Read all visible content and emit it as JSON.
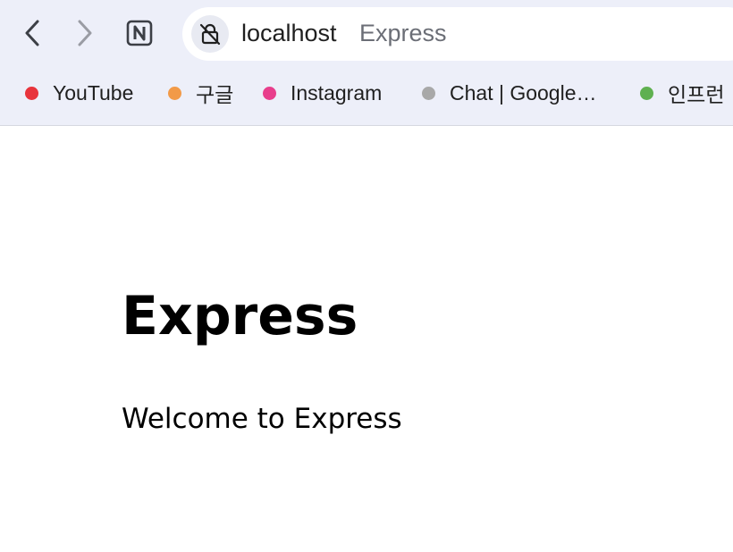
{
  "toolbar": {
    "back_icon": "chevron-left-icon",
    "forward_icon": "chevron-right-icon",
    "notion_icon": "notion-icon"
  },
  "address_bar": {
    "site_icon": "not-secure-icon",
    "host": "localhost",
    "page_title": "Express"
  },
  "bookmarks": [
    {
      "label": "YouTube",
      "color": "#e8343c"
    },
    {
      "label": "구글",
      "color": "#f29a48"
    },
    {
      "label": "Instagram",
      "color": "#e83e8c"
    },
    {
      "label": "Chat | Google…",
      "color": "#a8a8a8"
    },
    {
      "label": "인프런",
      "color": "#5fb050"
    }
  ],
  "page": {
    "title": "Express",
    "text": "Welcome to Express"
  }
}
